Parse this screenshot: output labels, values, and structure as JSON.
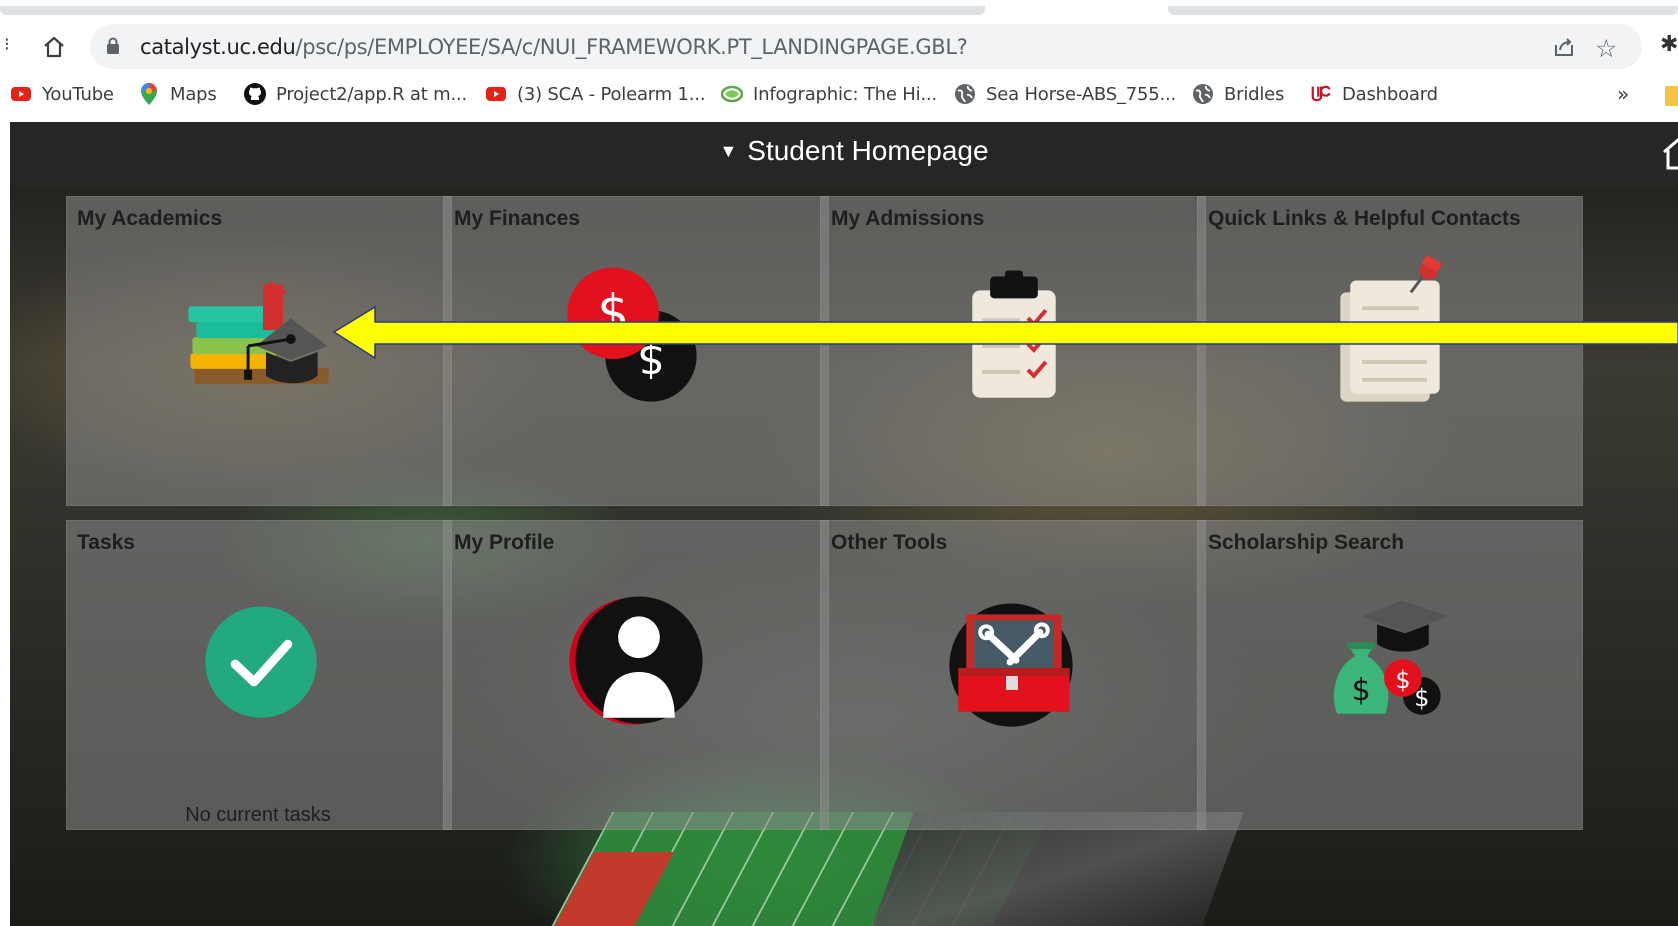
{
  "browser": {
    "url_host": "catalyst.uc.edu",
    "url_path": "/psc/ps/EMPLOYEE/SA/c/NUI_FRAMEWORK.PT_LANDINGPAGE.GBL?",
    "bookmarks": [
      {
        "label": "YouTube",
        "icon": "youtube-icon"
      },
      {
        "label": "Maps",
        "icon": "maps-pin-icon"
      },
      {
        "label": "Project2/app.R at m...",
        "icon": "github-icon"
      },
      {
        "label": "(3) SCA - Polearm 1...",
        "icon": "youtube-icon"
      },
      {
        "label": "Infographic: The Hi...",
        "icon": "leaf-icon"
      },
      {
        "label": "Sea Horse-ABS_755...",
        "icon": "globe-icon"
      },
      {
        "label": "Bridles",
        "icon": "globe-icon"
      },
      {
        "label": "Dashboard",
        "icon": "uc-logo-icon"
      }
    ],
    "bookmarks_overflow": "»"
  },
  "header": {
    "title": "Student Homepage"
  },
  "tiles": [
    {
      "title": "My Academics",
      "icon": "academics-books-cap-icon"
    },
    {
      "title": "My Finances",
      "icon": "finances-dollar-coins-icon"
    },
    {
      "title": "My Admissions",
      "icon": "admissions-clipboard-icon"
    },
    {
      "title": "Quick Links & Helpful Contacts",
      "icon": "quick-links-notes-icon"
    },
    {
      "title": "Tasks",
      "icon": "tasks-checkmark-icon",
      "note": "No current tasks"
    },
    {
      "title": "My Profile",
      "icon": "profile-person-icon"
    },
    {
      "title": "Other Tools",
      "icon": "tools-toolbox-icon"
    },
    {
      "title": "Scholarship Search",
      "icon": "scholarship-money-bag-icon"
    }
  ],
  "annotation": {
    "type": "pointer-arrow",
    "color": "#ffff00",
    "points_to": "My Academics"
  }
}
